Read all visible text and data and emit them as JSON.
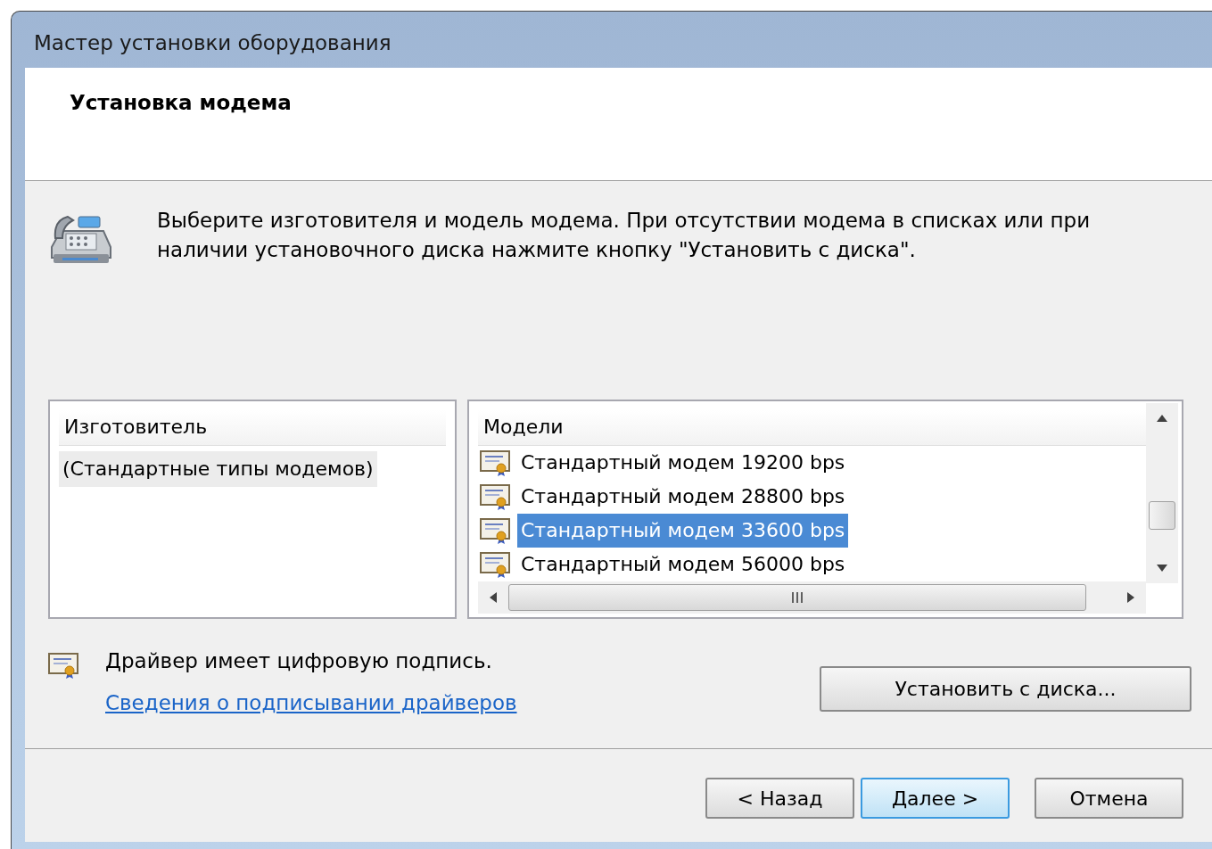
{
  "window": {
    "title": "Мастер установки оборудования"
  },
  "header": {
    "title": "Установка модема"
  },
  "instruction": "Выберите изготовителя и модель модема. При отсутствии модема в списках или при наличии установочного диска нажмите кнопку \"Установить с диска\".",
  "manufacturers": {
    "heading": "Изготовитель",
    "items": [
      {
        "label": "(Стандартные типы модемов)",
        "selected": true
      }
    ]
  },
  "models": {
    "heading": "Модели",
    "items": [
      {
        "label": "Стандартный модем 19200 bps",
        "selected": false
      },
      {
        "label": "Стандартный модем 28800 bps",
        "selected": false
      },
      {
        "label": "Стандартный модем 33600 bps",
        "selected": true
      },
      {
        "label": "Стандартный модем 56000 bps",
        "selected": false
      }
    ]
  },
  "signature": {
    "text": "Драйвер имеет цифровую подпись.",
    "link": "Сведения о подписывании драйверов"
  },
  "install_disk_button": "Установить с диска...",
  "buttons": [
    {
      "label": "< Назад",
      "default": false
    },
    {
      "label": "Далее >",
      "default": true
    },
    {
      "label": "Отмена",
      "default": false
    }
  ]
}
